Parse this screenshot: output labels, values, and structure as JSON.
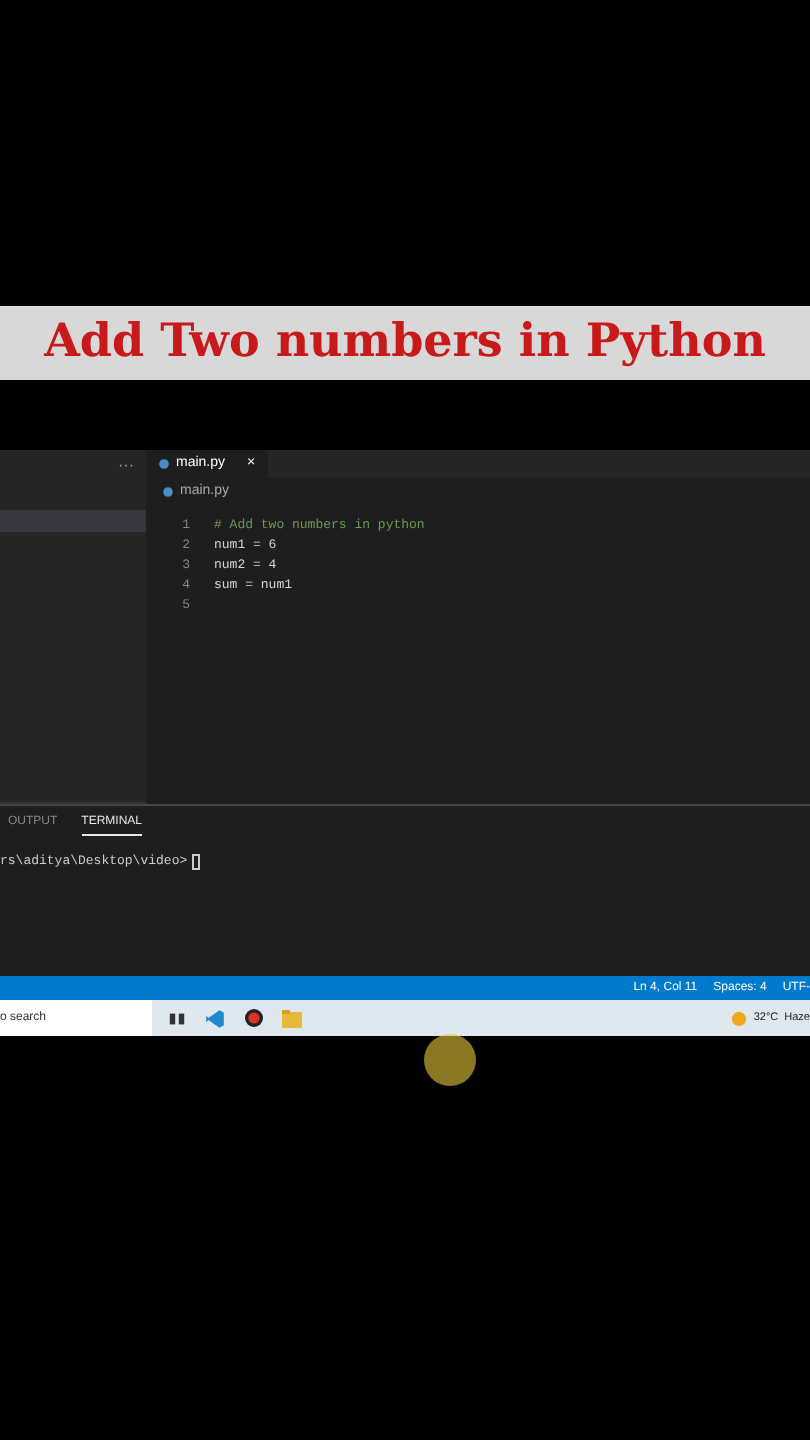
{
  "banner": {
    "title": "Add Two numbers in Python"
  },
  "sidebar": {
    "more": "···"
  },
  "editor": {
    "tabs": [
      {
        "label": "main.py",
        "selected": true,
        "close": "×"
      }
    ],
    "breadcrumb": "main.py",
    "lines": [
      {
        "number": "1",
        "code": "# Add two numbers in python",
        "kind": "comment"
      },
      {
        "number": "2",
        "code": "num1 = 6",
        "kind": "code"
      },
      {
        "number": "3",
        "code": "num2 = 4",
        "kind": "code"
      },
      {
        "number": "4",
        "code": "sum = num1",
        "kind": "code"
      },
      {
        "number": "5"
      }
    ]
  },
  "panel": {
    "tabs": [
      {
        "label": "OUTPUT",
        "selected": false
      },
      {
        "label": "TERMINAL",
        "selected": true
      }
    ],
    "prompt": "rs\\aditya\\Desktop\\video>"
  },
  "status_bar": {
    "items": [
      "Ln 4, Col 11",
      "Spaces: 4",
      "UTF-"
    ]
  },
  "taskbar": {
    "search": "o search",
    "temperature": "32°C",
    "weather": "Haze"
  }
}
